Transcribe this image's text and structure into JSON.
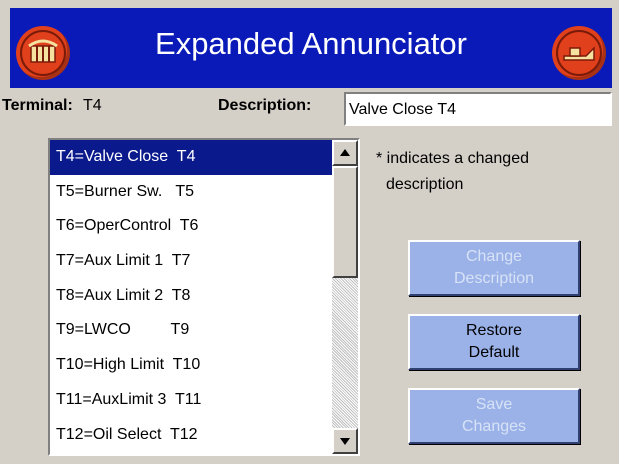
{
  "header": {
    "title": "Expanded Annunciator",
    "home_icon": "home-icon",
    "exit_icon": "exit-icon",
    "bar_color": "#0a1ab8",
    "icon_color": "#e0401c"
  },
  "terminal": {
    "label": "Terminal:",
    "value": "T4"
  },
  "description": {
    "label": "Description:",
    "value": "Valve Close  T4"
  },
  "list": {
    "selected_index": 0,
    "items": [
      {
        "label": "T4=Valve Close  T4"
      },
      {
        "label": "T5=Burner Sw.   T5"
      },
      {
        "label": "T6=OperControl  T6"
      },
      {
        "label": "T7=Aux Limit 1  T7"
      },
      {
        "label": "T8=Aux Limit 2  T8"
      },
      {
        "label": "T9=LWCO         T9"
      },
      {
        "label": "T10=High Limit  T10"
      },
      {
        "label": "T11=AuxLimit 3  T11"
      },
      {
        "label": "T12=Oil Select  T12"
      }
    ]
  },
  "note": {
    "line1": "* indicates a changed",
    "line2": "description"
  },
  "buttons": {
    "change": {
      "label": "Change\nDescription",
      "enabled": false
    },
    "restore": {
      "label": "Restore\nDefault",
      "enabled": true
    },
    "save": {
      "label": "Save\nChanges",
      "enabled": false
    },
    "button_color": "#9ab2e8"
  }
}
